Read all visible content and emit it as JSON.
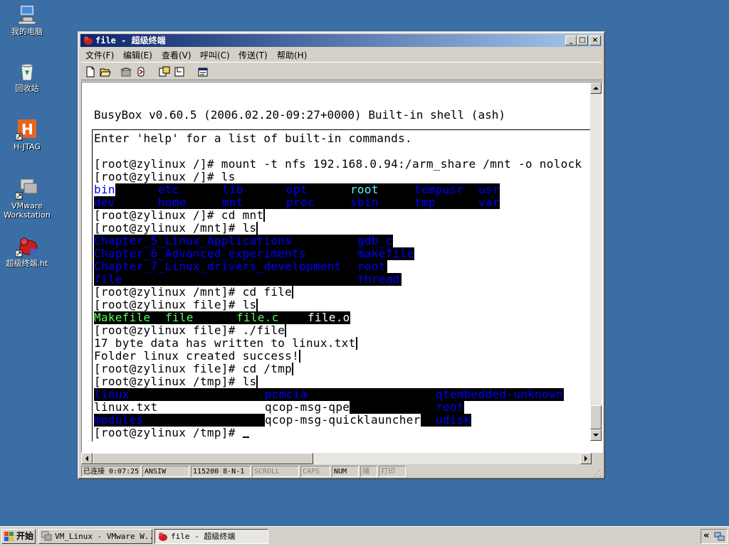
{
  "desktop": {
    "icons": [
      {
        "label": "我的电脑"
      },
      {
        "label": "回收站"
      },
      {
        "label": "H-JTAG"
      },
      {
        "label": "VMware\nWorkstation"
      },
      {
        "label": "超级终端.ht"
      }
    ]
  },
  "window": {
    "title": "file - 超级终端",
    "controls": {
      "minimize": "_",
      "maximize": "□",
      "close": "×"
    },
    "menu": [
      "文件(F)",
      "编辑(E)",
      "查看(V)",
      "呼叫(C)",
      "传送(T)",
      "帮助(H)"
    ],
    "toolbar_icons": [
      "new-icon",
      "open-icon",
      "call-icon",
      "disconnect-icon",
      "send-icon",
      "receive-icon",
      "properties-icon"
    ]
  },
  "terminal": {
    "banner": "BusyBox v0.60.5 (2006.02.20-09:27+0000) Built-in shell (ash)",
    "colors": {
      "blue": "#0000ff",
      "cyan": "#54fcfc",
      "green": "#55ff55",
      "black": "#000000",
      "white": "#ffffff"
    },
    "lines": {
      "help": "Enter 'help' for a list of built-in commands.",
      "cmd_mount": "[root@zylinux /]# mount -t nfs 192.168.0.94:/arm_share /mnt -o nolock",
      "cmd_ls1": "[root@zylinux /]# ls",
      "ls1_row1": [
        "bin",
        "etc",
        "lib",
        "opt",
        "root",
        "tempusr",
        "usr"
      ],
      "ls1_row2": [
        "dev",
        "home",
        "mnt",
        "proc",
        "sbin",
        "tmp",
        "var"
      ],
      "cmd_cd_mnt": "[root@zylinux /]# cd mnt",
      "cmd_ls2": "[root@zylinux /mnt]# ls",
      "ls2_left": [
        "Chapter_5_Linux_Applications",
        "Chapter_6_Advanced_experiments",
        "Chapter_7_Linux_drivers_development",
        "file"
      ],
      "ls2_right": [
        "gdb_c",
        "makefile",
        "root",
        "thread"
      ],
      "cmd_cd_file": "[root@zylinux /mnt]# cd file",
      "cmd_ls3": "[root@zylinux file]# ls",
      "ls3": [
        "Makefile",
        "file",
        "file.c",
        "file.o"
      ],
      "cmd_run": "[root@zylinux file]# ./file",
      "out1": "17 byte data has written to linux.txt",
      "out2": "Folder linux created success!",
      "cmd_cd_tmp": "[root@zylinux file]# cd /tmp",
      "cmd_ls4": "[root@zylinux /tmp]# ls",
      "ls4_row1": [
        "linux",
        "pcmcia",
        "qtembedded-unknown"
      ],
      "ls4_row2": [
        "linux.txt",
        "qcop-msg-qpe",
        "root"
      ],
      "ls4_row3": [
        "modules",
        "qcop-msg-quicklauncher",
        "udisk"
      ],
      "prompt_last": "[root@zylinux /tmp]# "
    }
  },
  "statusbar": {
    "connected": "已连接 0:07:25",
    "emulation": "ANSIW",
    "port": "115200 8-N-1",
    "scroll": "SCROLL",
    "caps": "CAPS",
    "num": "NUM",
    "capture": "捕",
    "print": "打印"
  },
  "taskbar": {
    "start": "开始",
    "tasks": [
      "VM_Linux - VMware W...",
      "file - 超级终端"
    ],
    "tray_chevron": "«"
  }
}
